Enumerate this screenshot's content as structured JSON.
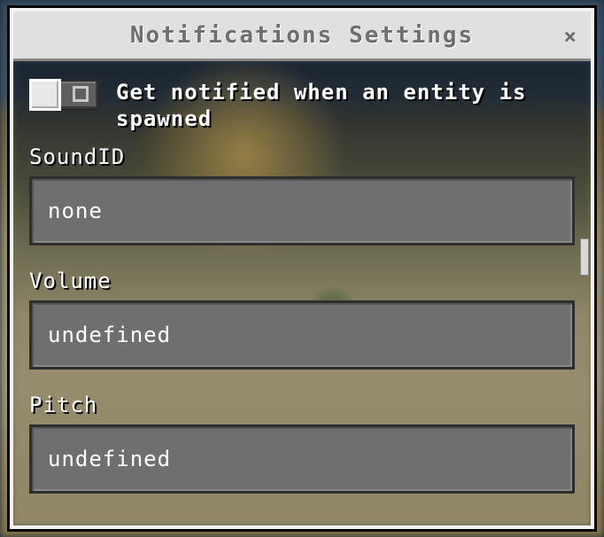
{
  "header": {
    "title": "Notifications Settings",
    "close_glyph": "×"
  },
  "toggle": {
    "label": "Get notified when an entity is spawned",
    "state": "off"
  },
  "fields": {
    "soundid": {
      "label": "SoundID",
      "value": "none"
    },
    "volume": {
      "label": "Volume",
      "value": "undefined"
    },
    "pitch": {
      "label": "Pitch",
      "value": "undefined"
    }
  }
}
